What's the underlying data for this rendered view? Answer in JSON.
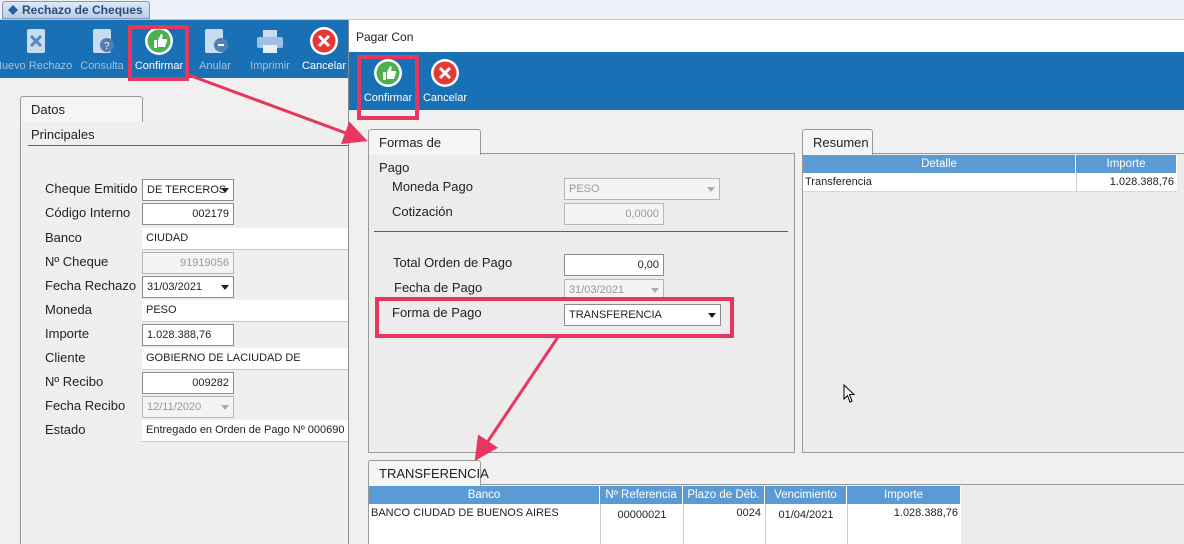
{
  "window": {
    "tab_title": "Rechazo de Cheques"
  },
  "main_toolbar": {
    "buttons": [
      {
        "label": "Nuevo Rechazo",
        "icon": "new-rechazo-icon"
      },
      {
        "label": "Consulta",
        "icon": "consulta-icon"
      },
      {
        "label": "Confirmar",
        "icon": "thumbs-up-icon"
      },
      {
        "label": "Anular",
        "icon": "anular-icon"
      },
      {
        "label": "Imprimir",
        "icon": "printer-icon"
      },
      {
        "label": "Cancelar",
        "icon": "cancel-icon"
      }
    ]
  },
  "datos": {
    "tab_label": "Datos Principales",
    "fields": [
      {
        "label": "Cheque Emitido",
        "value": "DE TERCEROS"
      },
      {
        "label": "Código Interno",
        "value": "002179"
      },
      {
        "label": "Banco",
        "value": "CIUDAD"
      },
      {
        "label": "Nº Cheque",
        "value": "91919056"
      },
      {
        "label": "Fecha Rechazo",
        "value": "31/03/2021"
      },
      {
        "label": "Moneda",
        "value": "PESO"
      },
      {
        "label": "Importe",
        "value": "1.028.388,76"
      },
      {
        "label": "Cliente",
        "value": "GOBIERNO DE LACIUDAD DE"
      },
      {
        "label": "Nº Recibo",
        "value": "009282"
      },
      {
        "label": "Fecha Recibo",
        "value": "12/11/2020"
      },
      {
        "label": "Estado",
        "value": "Entregado en Orden de Pago Nº 000690"
      }
    ]
  },
  "dialog": {
    "title": "Pagar Con",
    "toolbar": {
      "confirm_label": "Confirmar",
      "cancel_label": "Cancelar"
    },
    "formas": {
      "tab_label": "Formas de Pago",
      "moneda_label": "Moneda Pago",
      "moneda_value": "PESO",
      "cotizacion_label": "Cotización",
      "cotizacion_value": "0,0000",
      "total_label": "Total Orden de Pago",
      "total_value": "0,00",
      "fecha_label": "Fecha de Pago",
      "fecha_value": "31/03/2021",
      "forma_label": "Forma de Pago",
      "forma_value": "TRANSFERENCIA"
    },
    "resumen": {
      "tab_label": "Resumen",
      "columns": [
        "Detalle",
        "Importe"
      ],
      "rows": [
        {
          "detalle": "Transferencia",
          "importe": "1.028.388,76"
        }
      ]
    },
    "transferencia": {
      "tab_label": "TRANSFERENCIA",
      "columns": [
        "Banco",
        "Nº Referencia",
        "Plazo de Déb.",
        "Vencimiento",
        "Importe"
      ],
      "rows": [
        {
          "banco": "BANCO CIUDAD DE BUENOS AIRES",
          "referencia": "00000021",
          "plazo": "0024",
          "vencimiento": "01/04/2021",
          "importe": "1.028.388,76"
        }
      ]
    }
  },
  "colors": {
    "toolbar": "#1a70b5",
    "highlight": "#e8375e",
    "grid_header": "#5b9bd5"
  }
}
